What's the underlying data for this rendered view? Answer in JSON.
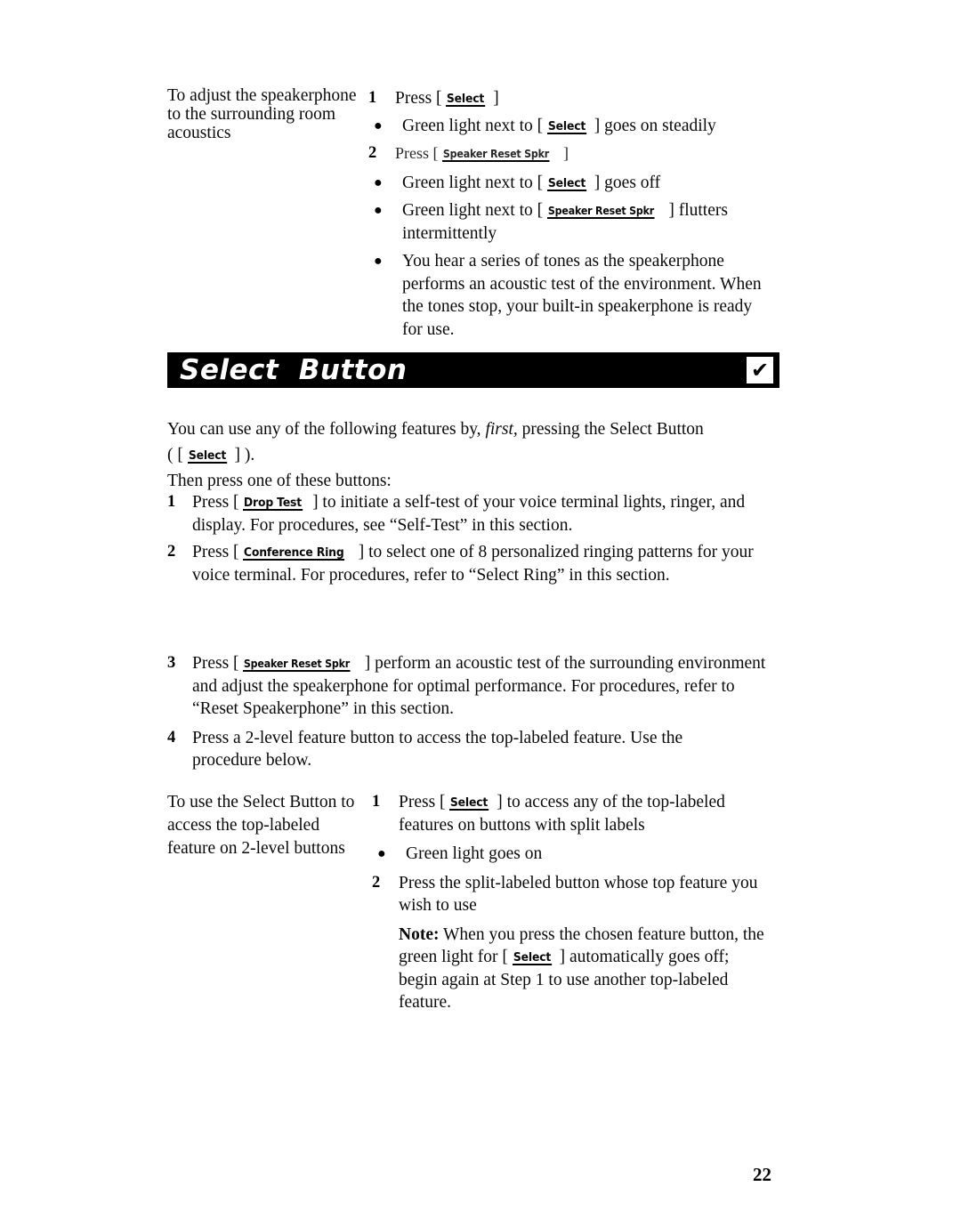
{
  "page": {
    "number": "22"
  },
  "top_procedure": {
    "left_label": "To adjust the speakerphone to the surrounding room acoustics",
    "steps": [
      {
        "num": "1",
        "press_word": "Press",
        "open_bracket": "[",
        "key": "Select",
        "close_bracket": "]",
        "after": "",
        "bullets": [
          {
            "before": "Green light next to [ ",
            "key": "Select",
            "after": " ] goes on steadily"
          }
        ]
      },
      {
        "num": "2",
        "press_word": "Press",
        "open_bracket": "[",
        "key": "Speaker Reset Spkr",
        "close_bracket": "]",
        "after": "",
        "bullets": [
          {
            "before": "Green light next to [ ",
            "key": "Select",
            "after": " ] goes off"
          },
          {
            "before": "Green light next to [ ",
            "key": "Speaker Reset Spkr",
            "after": " ] flutters intermittently"
          },
          {
            "before": "You hear a series of tones as the speakerphone performs an acoustic test of the environment. When the tones stop, your built-in speakerphone is ready for use.",
            "key": "",
            "after": ""
          }
        ]
      }
    ]
  },
  "section_header": {
    "title": "Select  Button",
    "marker": "✔"
  },
  "intro": {
    "line1_a": "You can use any of the following features by, ",
    "line1_italic": "first,",
    "line1_b": " pressing the Select Button",
    "line2_a": "( [ ",
    "line2_key": "Select",
    "line2_b": " ] ).",
    "line3": "Then press one of these buttons:"
  },
  "feature_list": [
    {
      "num": "1",
      "before": "Press [ ",
      "key": "Drop Test",
      "after": " ] to initiate a self-test of your voice terminal lights, ringer, and display. For procedures, see “Self-Test” in this section."
    },
    {
      "num": "2",
      "before": "Press [ ",
      "key": "Conference Ring",
      "after": " ] to select one of 8 personalized ringing patterns for your voice terminal. For procedures, refer to “Select Ring” in this section."
    },
    {
      "num": "3",
      "before": "Press [ ",
      "key": "Speaker Reset Spkr",
      "after": " ] perform an acoustic test of the surrounding environment and adjust the speakerphone for optimal performance. For procedures, refer to “Reset Speakerphone” in this section."
    },
    {
      "num": "4",
      "before": "Press a 2-level feature button to access the top-labeled feature. Use the procedure below.",
      "key": "",
      "after": ""
    }
  ],
  "bottom_procedure": {
    "left_label": "To use the Select Button to access the top-labeled feature on 2-level buttons",
    "steps": [
      {
        "num": "1",
        "before": "Press [ ",
        "key": "Select",
        "after": " ] to access any of the top-labeled features on buttons with split labels",
        "bullets": [
          {
            "text": "Green light goes on"
          }
        ]
      },
      {
        "num": "2",
        "before": "Press the split-labeled button whose top feature you wish to use",
        "key": "",
        "after": "",
        "bullets": []
      }
    ],
    "note": {
      "label": "Note:",
      "part_a": " When you press the chosen feature button, the green light for [ ",
      "key": "Select",
      "part_b": " ] automatically goes off; begin again at Step 1 to use another top-labeled feature."
    }
  }
}
